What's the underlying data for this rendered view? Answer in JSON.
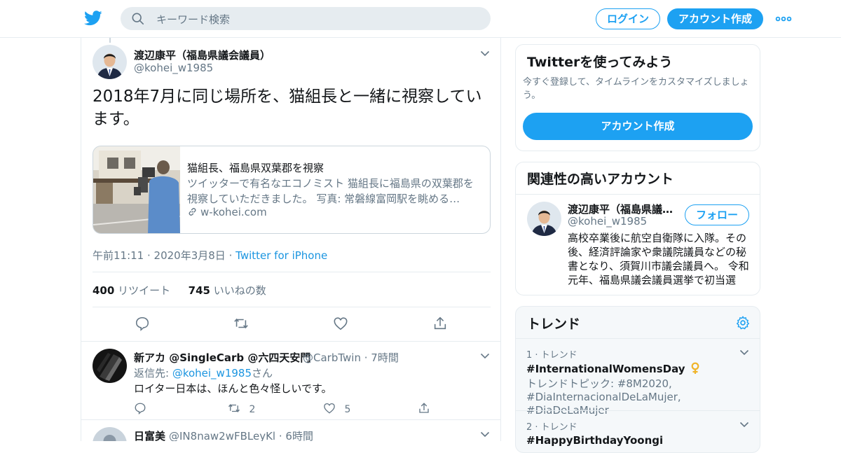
{
  "header": {
    "search_placeholder": "キーワード検索",
    "login_label": "ログイン",
    "signup_label": "アカウント作成",
    "brand_color": "#1da1f2"
  },
  "tweet": {
    "author_name": "渡辺康平（福島県議会議員）",
    "author_handle": "@kohei_w1985",
    "text": "2018年7月に同じ場所を、猫組長と一緒に視察しています。",
    "card": {
      "title": "猫組長、福島県双葉郡を視察",
      "description": "ツイッターで有名なエコノミスト 猫組長に福島県の双葉郡を視察していただきました。 写真: 常磐線富岡駅を眺める…",
      "domain": "w-kohei.com"
    },
    "timestamp": "午前11:11 · 2020年3月8日",
    "dot": "·",
    "source": "Twitter for iPhone",
    "retweets_count": "400",
    "retweets_label": "リツイート",
    "likes_count": "745",
    "likes_label": "いいねの数"
  },
  "replies": [
    {
      "name": "新アカ @SingleCarb @六四天安門",
      "handle": "@CarbTwin",
      "time": "· 7時間",
      "reply_prefix": "返信先: ",
      "reply_handle": "@kohei_w1985",
      "reply_suffix": "さん",
      "text": "ロイター日本は、ほんと色々怪しいです。",
      "retweets": "2",
      "likes": "5"
    },
    {
      "name": "日富美",
      "handle": "@IN8naw2wFBLeyKl",
      "time": "· 6時間"
    }
  ],
  "sidebar": {
    "signup_panel": {
      "title": "Twitterを使ってみよう",
      "subtitle": "今すぐ登録して、タイムラインをカスタマイズしましょう。",
      "button": "アカウント作成"
    },
    "related_panel": {
      "title": "関連性の高いアカウント",
      "name": "渡辺康平（福島県議…",
      "handle": "@kohei_w1985",
      "follow_label": "フォロー",
      "bio": "高校卒業後に航空自衛隊に入隊。その後、経済評論家や衆議院議員などの秘書となり、須賀川市議会議員へ。 令和元年、福島県議会議員選挙で初当選"
    },
    "trends_panel": {
      "title": "トレンド",
      "items": [
        {
          "rank": "1 · トレンド",
          "name": "#InternationalWomensDay",
          "topics": "トレンドトピック: #8M2020, #DiaInternacionalDeLaMujer, #DiaDeLaMujer"
        },
        {
          "rank": "2 · トレンド",
          "name": "#HappyBirthdayYoongi"
        }
      ]
    }
  }
}
